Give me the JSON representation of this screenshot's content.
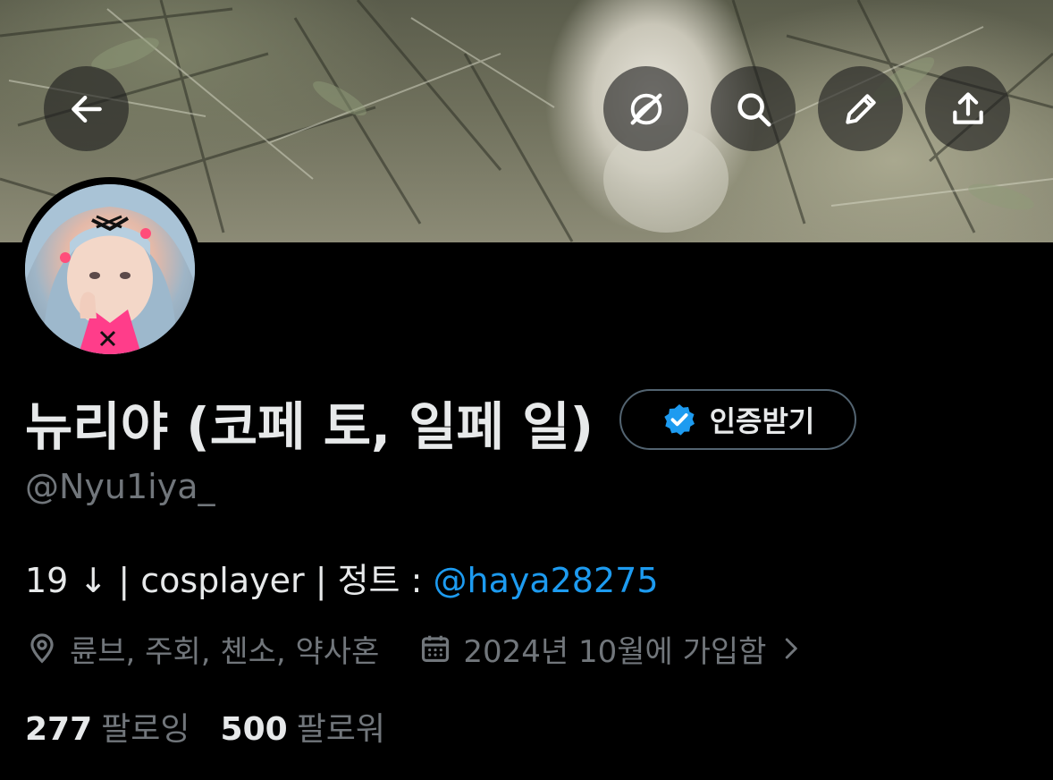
{
  "header": {
    "back_icon": "arrow-left-icon",
    "actions": [
      {
        "name": "translate-off",
        "icon": "globe-slash-icon"
      },
      {
        "name": "search",
        "icon": "search-icon"
      },
      {
        "name": "edit",
        "icon": "pencil-icon"
      },
      {
        "name": "share",
        "icon": "share-upload-icon"
      }
    ]
  },
  "profile": {
    "display_name": "뉴리야 (코페 토, 일페 일)",
    "handle": "@Nyu1iya_",
    "verify_button": {
      "label": "인증받기",
      "icon": "verified-badge-icon",
      "badge_color": "#1d9bf0"
    },
    "bio": {
      "text": "19 ↓ | cosplayer | 정트 : ",
      "mention": "@haya28275"
    },
    "location": "륜브, 주회, 첸소, 약사혼",
    "joined": "2024년 10월에 가입함",
    "following": {
      "count": "277",
      "label": "팔로잉"
    },
    "followers": {
      "count": "500",
      "label": "팔로워"
    }
  },
  "colors": {
    "background": "#000000",
    "text": "#e7e9ea",
    "muted": "#71767b",
    "accent": "#1d9bf0"
  }
}
